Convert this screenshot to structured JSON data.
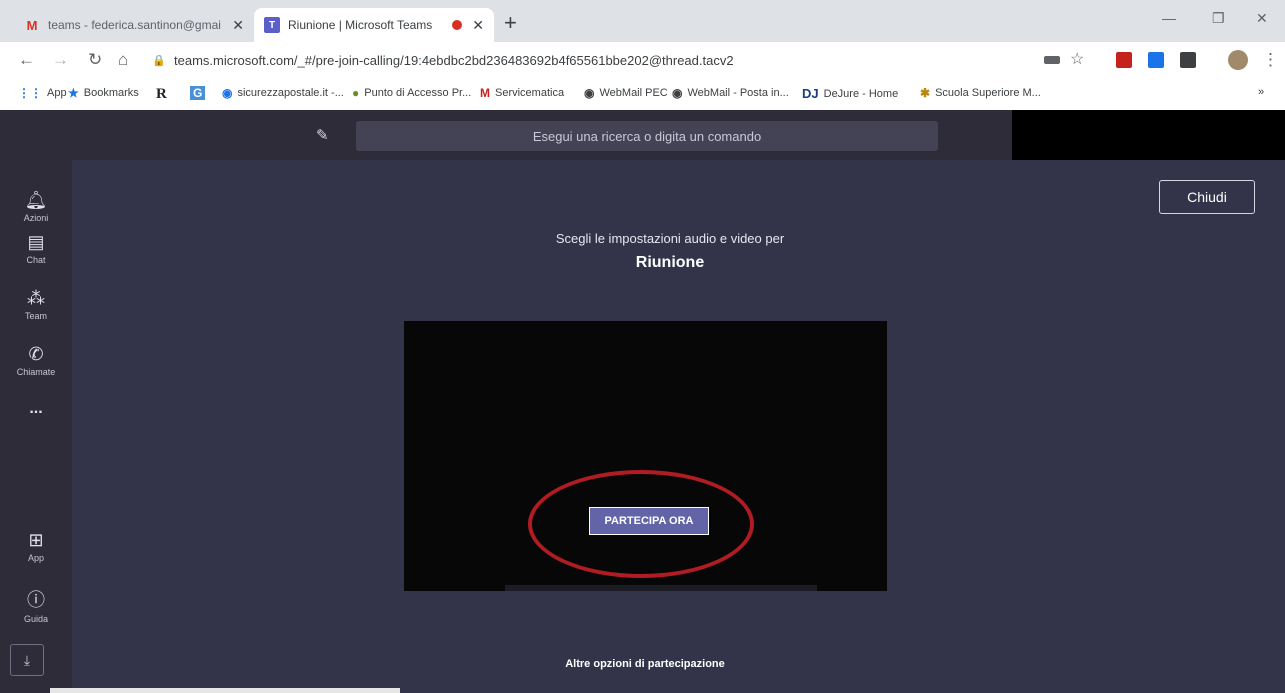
{
  "browser": {
    "tabs": [
      {
        "title": "teams - federica.santinon@gmai",
        "favicon": "gmail-icon",
        "active": false
      },
      {
        "title": "Riunione | Microsoft Teams",
        "favicon": "teams-icon",
        "active": true
      }
    ],
    "url": "teams.microsoft.com/_#/pre-join-calling/19:4ebdbc2bd236483692b4f65561bbe202@thread.tacv2",
    "bookmarks": [
      {
        "label": "App",
        "icon": "apps-grid-icon"
      },
      {
        "label": "Bookmarks",
        "icon": "star-icon"
      },
      {
        "label": "",
        "icon": "r-icon"
      },
      {
        "label": "",
        "icon": "g-icon"
      },
      {
        "label": "sicurezzapostale.it -...",
        "icon": "globe-icon"
      },
      {
        "label": "Punto di Accesso Pr...",
        "icon": "pin-icon"
      },
      {
        "label": "Servicematica",
        "icon": "m-icon"
      },
      {
        "label": "WebMail PEC",
        "icon": "globe-icon"
      },
      {
        "label": "WebMail - Posta in...",
        "icon": "globe-icon"
      },
      {
        "label": "DeJure - Home",
        "icon": "dj-icon"
      },
      {
        "label": "Scuola Superiore M...",
        "icon": "ssm-icon"
      }
    ]
  },
  "teams": {
    "search_placeholder": "Esegui una ricerca o digita un comando",
    "rail": [
      {
        "label": "Azioni",
        "icon": "bell-icon"
      },
      {
        "label": "Chat",
        "icon": "chat-icon"
      },
      {
        "label": "Team",
        "icon": "team-icon"
      },
      {
        "label": "Chiamate",
        "icon": "phone-icon"
      },
      {
        "label": "...",
        "icon": "more-icon"
      },
      {
        "label": "App",
        "icon": "apps-icon"
      },
      {
        "label": "Guida",
        "icon": "help-icon"
      }
    ],
    "close_label": "Chiudi",
    "prompt": "Scegli le impostazioni audio e video per",
    "meeting_title": "Riunione",
    "join_label": "PARTECIPA ORA",
    "other_options": "Altre opzioni di partecipazione"
  },
  "colors": {
    "teams_bg": "#33344a",
    "rail_bg": "#2d2c38",
    "accent": "#6264a7",
    "highlight_oval": "#b01c22"
  }
}
